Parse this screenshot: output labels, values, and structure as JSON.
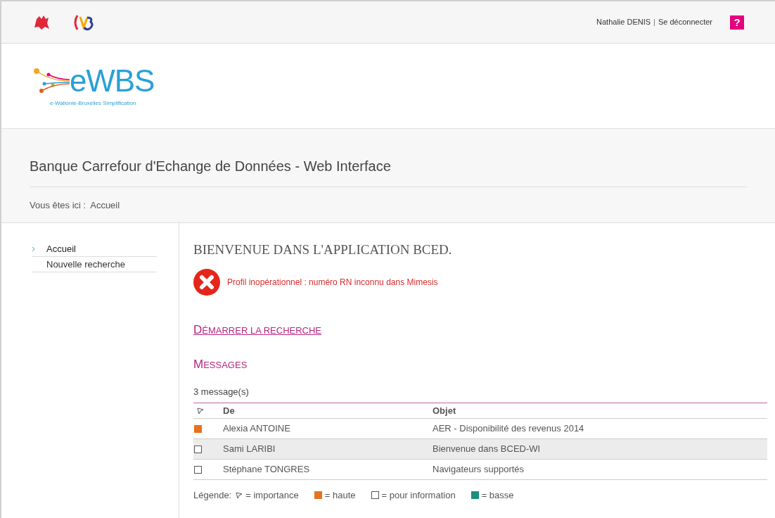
{
  "header": {
    "user": "Nathalie DENIS",
    "separator": "|",
    "logout": "Se déconnecter",
    "help": "?"
  },
  "logo": {
    "wordmark": "eWBS",
    "tagline": "e-Wallonie-Bruxelles Simplification"
  },
  "page_title": "Banque Carrefour d'Echange de Données - Web Interface",
  "breadcrumb": {
    "label": "Vous êtes ici :",
    "current": "Accueil"
  },
  "sidebar": {
    "items": [
      {
        "label": "Accueil",
        "selected": true
      },
      {
        "label": "Nouvelle recherche",
        "selected": false
      }
    ]
  },
  "main": {
    "heading": "BIENVENUE DANS L'APPLICATION BCED.",
    "error": "Profil inopérationnel : numéro RN inconnu dans Mimesis",
    "start_link": "DÉMARRER LA RECHERCHE",
    "messages_heading": "MESSAGES",
    "count": "3 message(s)",
    "table": {
      "columns": [
        "De",
        "Objet"
      ],
      "rows": [
        {
          "kind": "haute",
          "from": "Alexia ANTOINE",
          "subject": "AER - Disponibilité des revenus 2014",
          "highlighted": false
        },
        {
          "kind": "information",
          "from": "Sami LARIBI",
          "subject": "Bienvenue dans BCED-WI",
          "highlighted": true
        },
        {
          "kind": "information",
          "from": "Stéphane TONGRES",
          "subject": "Navigateurs supportés",
          "highlighted": false
        }
      ]
    },
    "legend": {
      "label": "Légende:",
      "items": [
        {
          "kind": "importance",
          "text": "= importance"
        },
        {
          "kind": "haute",
          "text": "= haute"
        },
        {
          "kind": "information",
          "text": "= pour information"
        },
        {
          "kind": "basse",
          "text": "= basse"
        }
      ]
    }
  }
}
